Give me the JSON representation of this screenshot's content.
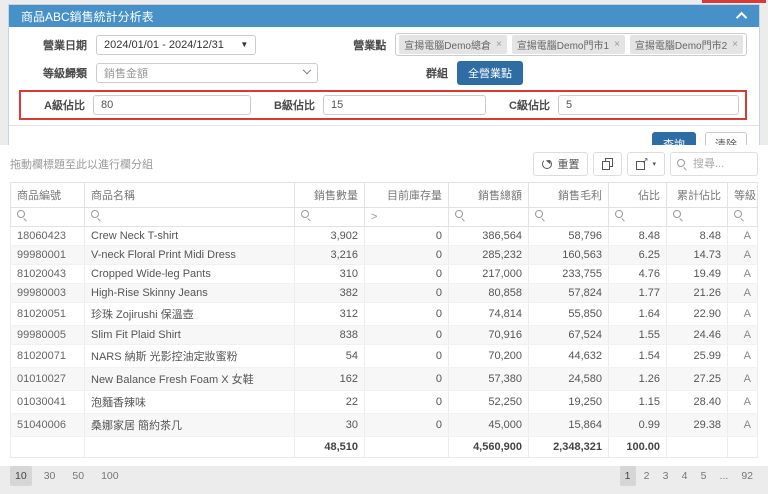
{
  "colors": {
    "header_bar": "#4791c8",
    "primary_button": "#2e6da4",
    "annotation_red": "#d93a35",
    "tag_bg": "#e4e4e4"
  },
  "icons": {
    "collapse": "chevron-up-icon",
    "date_caret": "caret-down-icon",
    "select_caret": "chevron-down-icon",
    "reset": "refresh-icon",
    "copy": "copy-icon",
    "export": "export-icon",
    "search": "search-icon",
    "tag_close": "x-icon"
  },
  "panel": {
    "title": "商品ABC銷售統計分析表",
    "filters": {
      "business_date": {
        "label": "營業日期",
        "value": "2024/01/01 - 2024/12/31"
      },
      "business_points": {
        "label": "營業點",
        "tags": [
          "宣揚電腦Demo總倉",
          "宣揚電腦Demo門市1",
          "宣揚電腦Demo門市2"
        ]
      },
      "level_classification": {
        "label": "等級歸類",
        "value": "銷售金額"
      },
      "group": {
        "label": "群組",
        "button_label": "全營業點"
      },
      "a_ratio": {
        "label": "A級佔比",
        "value": "80"
      },
      "b_ratio": {
        "label": "B級佔比",
        "value": "15"
      },
      "c_ratio": {
        "label": "C級佔比",
        "value": "5"
      }
    },
    "actions": {
      "query": "查詢",
      "clear": "清除"
    }
  },
  "grid": {
    "group_hint": "拖動欄標題至此以進行欄分組",
    "toolbar": {
      "reset_label": "重置",
      "search_placeholder": "搜尋..."
    },
    "columns": [
      "商品編號",
      "商品名稱",
      "銷售數量",
      "目前庫存量",
      "銷售總額",
      "銷售毛利",
      "佔比",
      "累計佔比",
      "等級"
    ],
    "filter_operators": [
      "search",
      "search",
      "search",
      ">",
      "search",
      "search",
      "search",
      "search",
      "search"
    ],
    "rows": [
      [
        "18060423",
        "Crew Neck T-shirt",
        "3,902",
        "0",
        "386,564",
        "58,796",
        "8.48",
        "8.48",
        "A"
      ],
      [
        "99980001",
        "V-neck Floral Print Midi Dress",
        "3,216",
        "0",
        "285,232",
        "160,563",
        "6.25",
        "14.73",
        "A"
      ],
      [
        "81020043",
        "Cropped Wide-leg Pants",
        "310",
        "0",
        "217,000",
        "233,755",
        "4.76",
        "19.49",
        "A"
      ],
      [
        "99980003",
        "High-Rise Skinny Jeans",
        "382",
        "0",
        "80,858",
        "57,824",
        "1.77",
        "21.26",
        "A"
      ],
      [
        "81020051",
        "珍珠 Zojirushi 保溫壺",
        "312",
        "0",
        "74,814",
        "55,850",
        "1.64",
        "22.90",
        "A"
      ],
      [
        "99980005",
        "Slim Fit Plaid Shirt",
        "838",
        "0",
        "70,916",
        "67,524",
        "1.55",
        "24.46",
        "A"
      ],
      [
        "81020071",
        "NARS 納斯 光影控油定妝蜜粉",
        "54",
        "0",
        "70,200",
        "44,632",
        "1.54",
        "25.99",
        "A"
      ],
      [
        "01010027",
        "New Balance Fresh Foam X 女鞋",
        "162",
        "0",
        "57,380",
        "24,580",
        "1.26",
        "27.25",
        "A"
      ],
      [
        "01030041",
        "泡麵香辣味",
        "22",
        "0",
        "52,250",
        "19,250",
        "1.15",
        "28.40",
        "A"
      ],
      [
        "51040006",
        "桑娜家居 簡約茶几",
        "30",
        "0",
        "45,000",
        "15,864",
        "0.99",
        "29.38",
        "A"
      ]
    ],
    "totals": [
      "",
      "",
      "48,510",
      "",
      "4,560,900",
      "2,348,321",
      "100.00",
      "",
      ""
    ],
    "pagination": {
      "page_sizes": [
        "10",
        "30",
        "50",
        "100"
      ],
      "active_size": "10",
      "pages": [
        "1",
        "2",
        "3",
        "4",
        "5",
        "...",
        "92"
      ],
      "active_page": "1"
    }
  }
}
